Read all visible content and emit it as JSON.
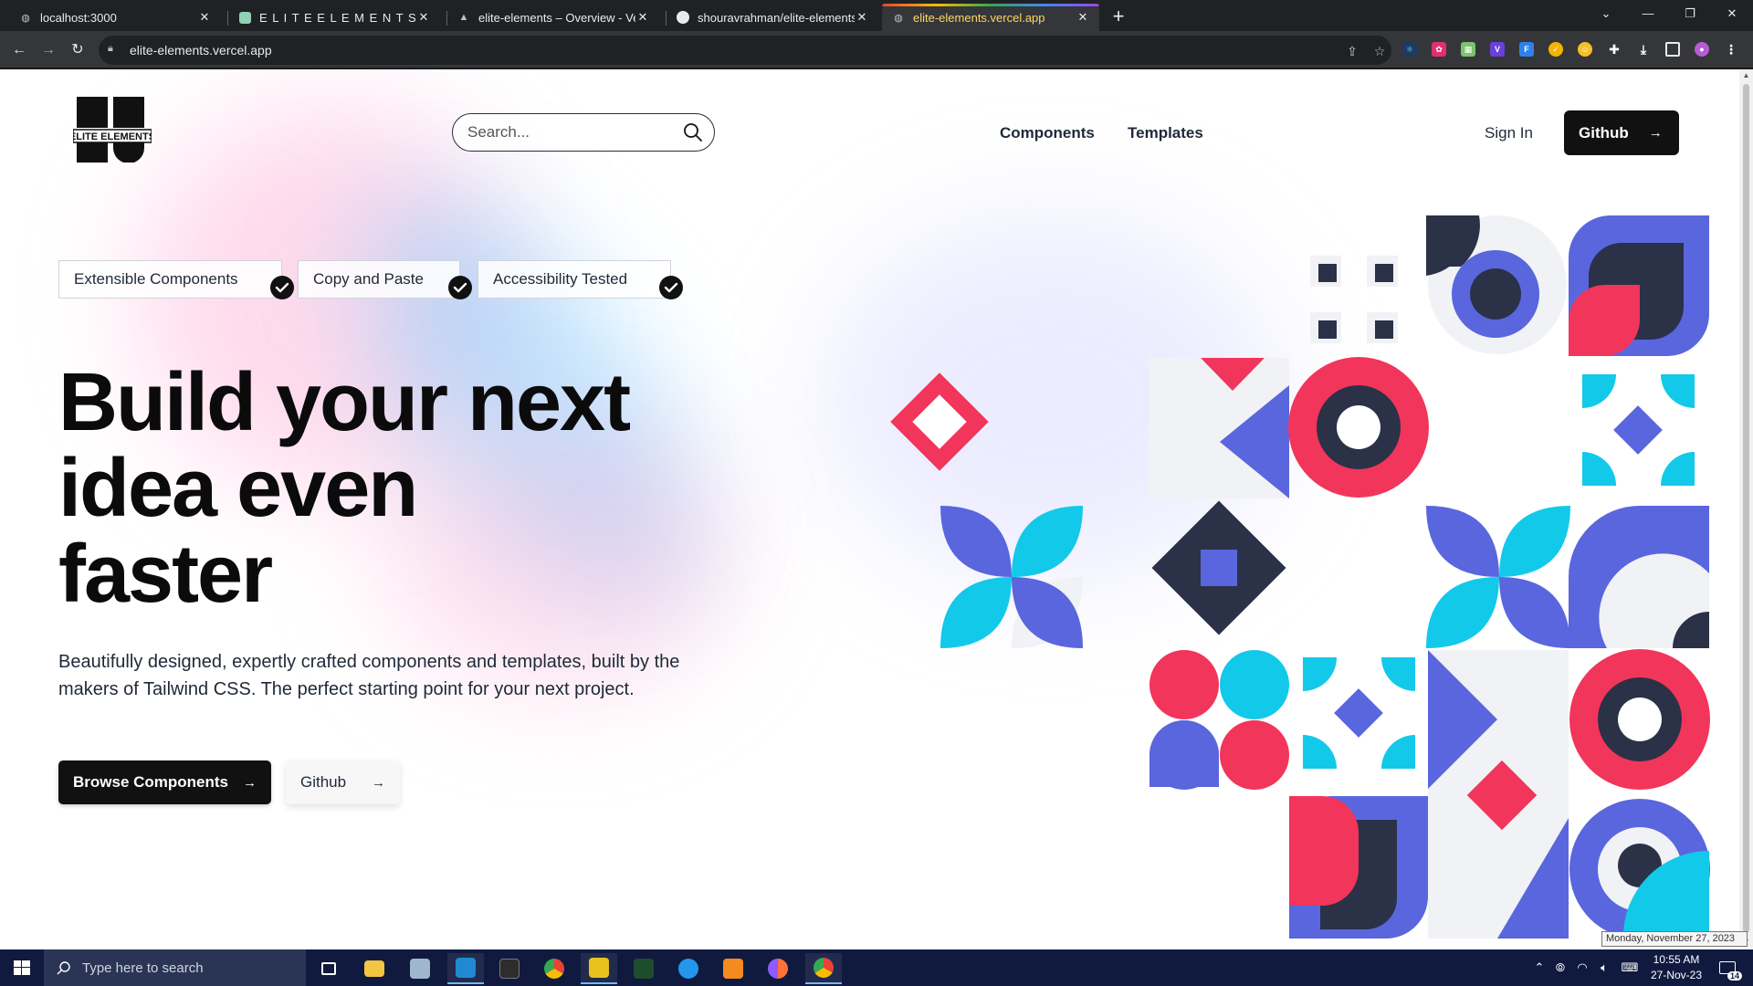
{
  "browser": {
    "tabs": [
      {
        "title": "localhost:3000",
        "icon": "globe-icon"
      },
      {
        "title": "E L I T E  E L E M E N T S",
        "icon": "app-favicon-icon"
      },
      {
        "title": "elite-elements – Overview - Verc",
        "icon": "vercel-icon"
      },
      {
        "title": "shouravrahman/elite-elements",
        "icon": "github-icon"
      },
      {
        "title": "elite-elements.vercel.app",
        "icon": "globe-icon",
        "active": true
      }
    ],
    "url": "elite-elements.vercel.app"
  },
  "header": {
    "logo_text": "ELITE ELEMENTS",
    "search_placeholder": "Search...",
    "nav": [
      "Components",
      "Templates"
    ],
    "signin": "Sign In",
    "github": "Github"
  },
  "badges": [
    "Extensible Components",
    "Copy and Paste",
    "Accessibility Tested"
  ],
  "hero": {
    "lines": [
      "Build your next",
      "idea even",
      "faster"
    ],
    "description": "Beautifully designed, expertly crafted components and templates, built by the makers of Tailwind CSS. The perfect starting point for your next project.",
    "primary_button": "Browse Components",
    "secondary_button": "Github"
  },
  "colors": {
    "navy": "#2b3147",
    "indigo": "#5a66dd",
    "cyan": "#12c9ea",
    "red": "#f2355b",
    "tile_gray": "#f1f2f5"
  },
  "taskbar": {
    "search_placeholder": "Type here to search",
    "time": "10:55 AM",
    "date": "27-Nov-23",
    "tooltip": "Monday, November 27, 2023",
    "notifications": "14"
  }
}
